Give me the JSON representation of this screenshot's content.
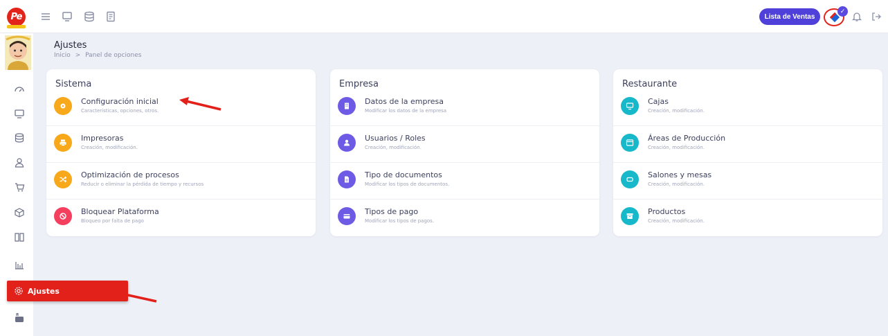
{
  "topbar": {
    "logo_text": "Pe",
    "sales_button": "Lista de Ventas",
    "accent": "#4e40d8"
  },
  "sidebar": {
    "active_label": "Ajustes",
    "active_color": "#e3211b"
  },
  "header": {
    "title": "Ajustes",
    "breadcrumb_home": "Inicio",
    "breadcrumb_sep": ">",
    "breadcrumb_current": "Panel de opciones"
  },
  "cards": [
    {
      "title": "Sistema",
      "items": [
        {
          "label": "Configuración inicial",
          "sub": "Características, opciones, otros.",
          "icon": "gear-icon",
          "color": "#f7a81b"
        },
        {
          "label": "Impresoras",
          "sub": "Creación, modificación.",
          "icon": "printer-icon",
          "color": "#f7a81b"
        },
        {
          "label": "Optimización de procesos",
          "sub": "Reducir o eliminar la pérdida de tiempo y recursos",
          "icon": "shuffle-icon",
          "color": "#f7a81b"
        },
        {
          "label": "Bloquear Plataforma",
          "sub": "Bloqueo por falta de pago",
          "icon": "block-icon",
          "color": "#f43f5e"
        }
      ]
    },
    {
      "title": "Empresa",
      "items": [
        {
          "label": "Datos de la empresa",
          "sub": "Modificar los datos de la empresa",
          "icon": "building-icon",
          "color": "#6d5be6"
        },
        {
          "label": "Usuarios / Roles",
          "sub": "Creación, modificación.",
          "icon": "user-icon",
          "color": "#6d5be6"
        },
        {
          "label": "Tipo de documentos",
          "sub": "Modificar los tipos de documentos.",
          "icon": "document-icon",
          "color": "#6d5be6"
        },
        {
          "label": "Tipos de pago",
          "sub": "Modificar los tipos de pagos.",
          "icon": "credit-card-icon",
          "color": "#6d5be6"
        }
      ]
    },
    {
      "title": "Restaurante",
      "items": [
        {
          "label": "Cajas",
          "sub": "Creación, modificación.",
          "icon": "monitor-icon",
          "color": "#17b8c9"
        },
        {
          "label": "Áreas de Producción",
          "sub": "Creación, modificación.",
          "icon": "window-icon",
          "color": "#17b8c9"
        },
        {
          "label": "Salones y mesas",
          "sub": "Creación, modificación.",
          "icon": "table-icon",
          "color": "#17b8c9"
        },
        {
          "label": "Productos",
          "sub": "Creación, modificación.",
          "icon": "archive-icon",
          "color": "#17b8c9"
        }
      ]
    }
  ]
}
